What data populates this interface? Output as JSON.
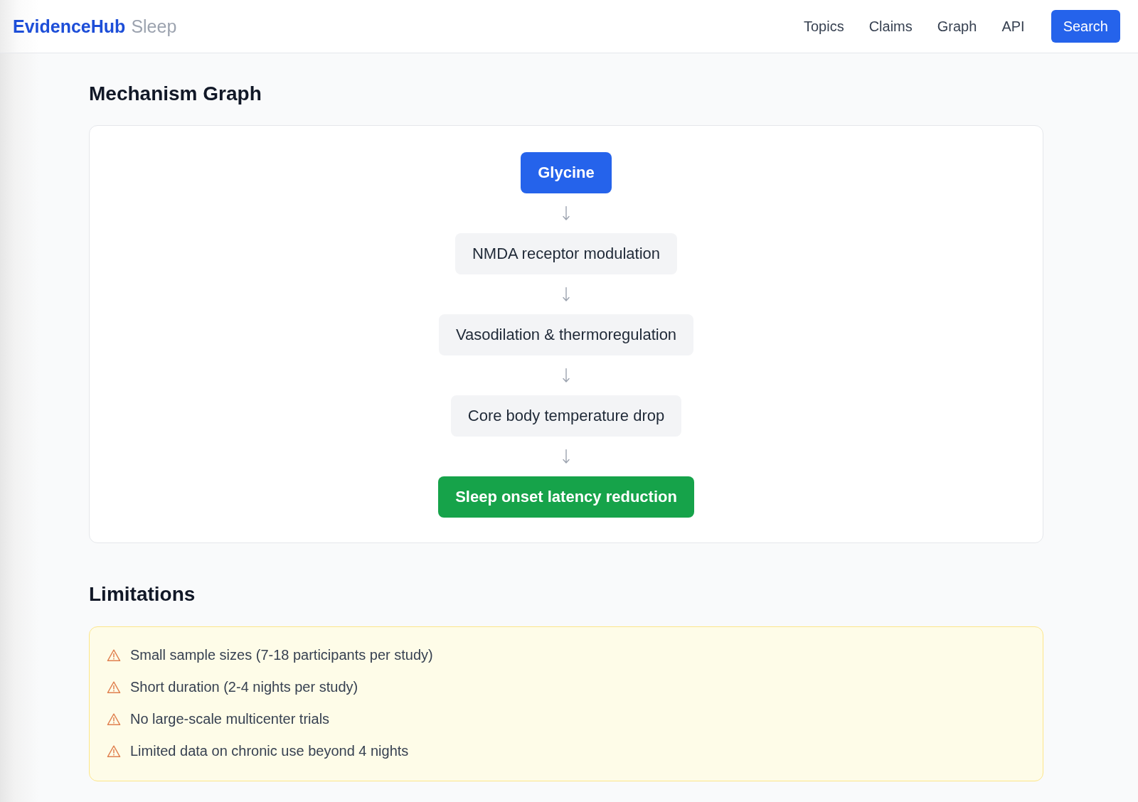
{
  "header": {
    "brand": "EvidenceHub",
    "section": "Sleep",
    "nav": [
      {
        "label": "Topics"
      },
      {
        "label": "Claims"
      },
      {
        "label": "Graph"
      },
      {
        "label": "API"
      }
    ],
    "search_button": "Search"
  },
  "mechanism_graph": {
    "title": "Mechanism Graph",
    "nodes": [
      {
        "label": "Glycine",
        "kind": "start"
      },
      {
        "label": "NMDA receptor modulation",
        "kind": "step"
      },
      {
        "label": "Vasodilation & thermoregulation",
        "kind": "step"
      },
      {
        "label": "Core body temperature drop",
        "kind": "step"
      },
      {
        "label": "Sleep onset latency reduction",
        "kind": "outcome"
      }
    ]
  },
  "limitations": {
    "title": "Limitations",
    "items": [
      "Small sample sizes (7-18 participants per study)",
      "Short duration (2-4 nights per study)",
      "No large-scale multicenter trials",
      "Limited data on chronic use beyond 4 nights"
    ]
  }
}
